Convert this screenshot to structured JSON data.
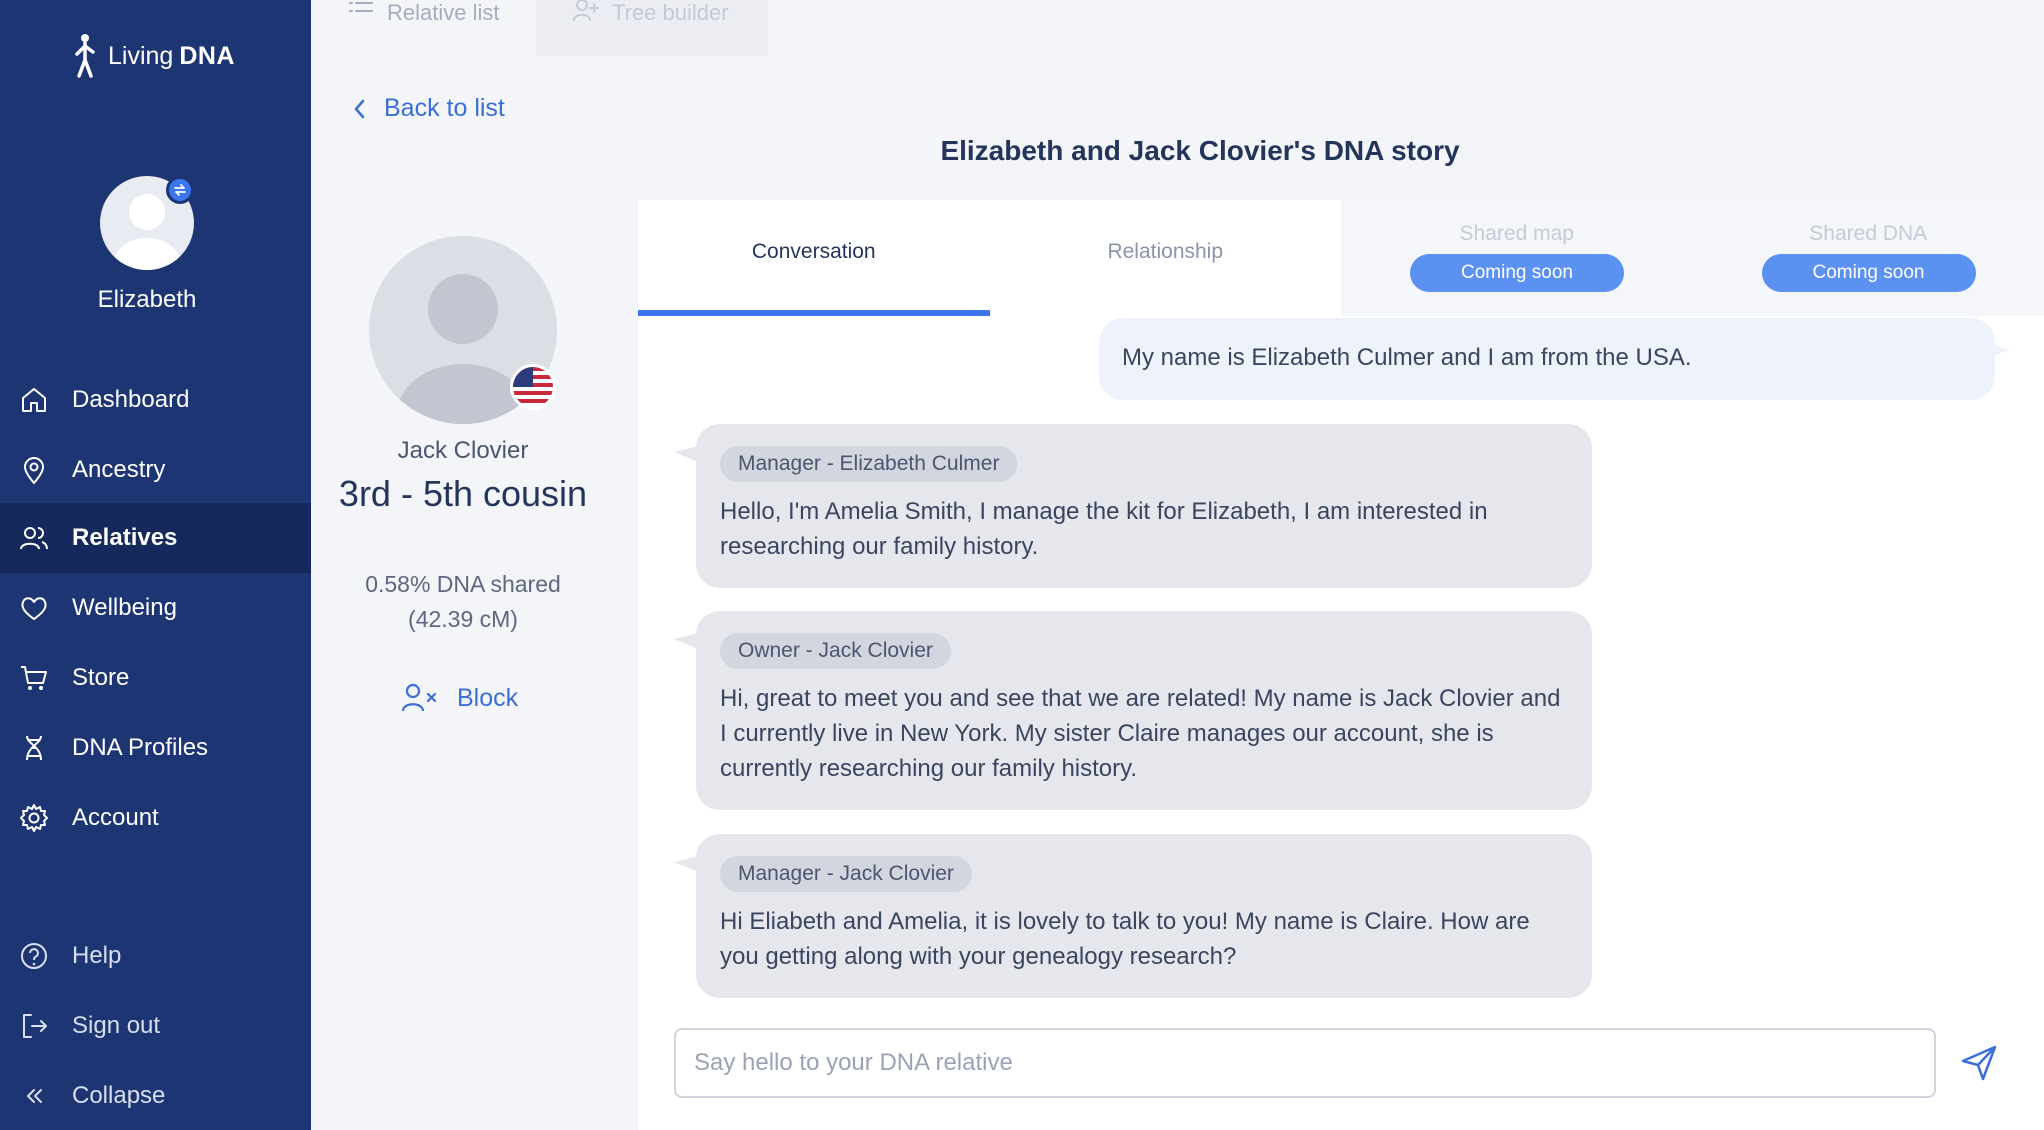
{
  "app": {
    "brand_light": "Living",
    "brand_bold": "DNA"
  },
  "user": {
    "name": "Elizabeth"
  },
  "sidebar": {
    "items": [
      {
        "label": "Dashboard",
        "icon": "home-icon"
      },
      {
        "label": "Ancestry",
        "icon": "map-pin-icon"
      },
      {
        "label": "Relatives",
        "icon": "users-icon",
        "active": true
      },
      {
        "label": "Wellbeing",
        "icon": "heart-icon"
      },
      {
        "label": "Store",
        "icon": "cart-icon"
      },
      {
        "label": "DNA Profiles",
        "icon": "dna-icon"
      },
      {
        "label": "Account",
        "icon": "gear-icon"
      }
    ],
    "bottom": [
      {
        "label": "Help",
        "icon": "help-icon"
      },
      {
        "label": "Sign out",
        "icon": "sign-out-icon"
      },
      {
        "label": "Collapse",
        "icon": "collapse-icon"
      }
    ]
  },
  "top_tabs": [
    {
      "label": "Relative list",
      "icon": "list-icon"
    },
    {
      "label": "Tree builder",
      "icon": "add-user-icon"
    }
  ],
  "back_label": "Back to list",
  "page_title": "Elizabeth and Jack Clovier's DNA story",
  "relative": {
    "name": "Jack Clovier",
    "relationship": "3rd - 5th cousin",
    "dna_shared": "0.58% DNA shared",
    "cm": "(42.39 cM)",
    "block_label": "Block",
    "flag": "usa-flag-icon"
  },
  "tabs": [
    {
      "label": "Conversation",
      "active": true
    },
    {
      "label": "Relationship"
    },
    {
      "label": "Shared map",
      "badge": "Coming soon"
    },
    {
      "label": "Shared DNA",
      "badge": "Coming soon"
    }
  ],
  "conversation": {
    "my_message": "My name is Elizabeth Culmer and I am from the USA.",
    "messages": [
      {
        "sender": "Manager - Elizabeth Culmer",
        "text": "Hello, I'm Amelia Smith, I manage the kit for Elizabeth, I am interested in researching our family history."
      },
      {
        "sender": "Owner - Jack Clovier",
        "text": "Hi, great to meet you and see that we are related! My name is Jack Clovier and I currently live in New York. My sister Claire manages our account, she is currently researching our family history."
      },
      {
        "sender": "Manager - Jack Clovier",
        "text": "Hi Eliabeth and Amelia, it is lovely to talk to you! My name is Claire. How are you getting along with your genealogy research?"
      }
    ],
    "input_placeholder": "Say hello to your DNA relative"
  },
  "colors": {
    "sidebar": "#1e3573",
    "sidebar_active": "#16295c",
    "accent": "#3a76ee",
    "link": "#3a6fd6"
  }
}
